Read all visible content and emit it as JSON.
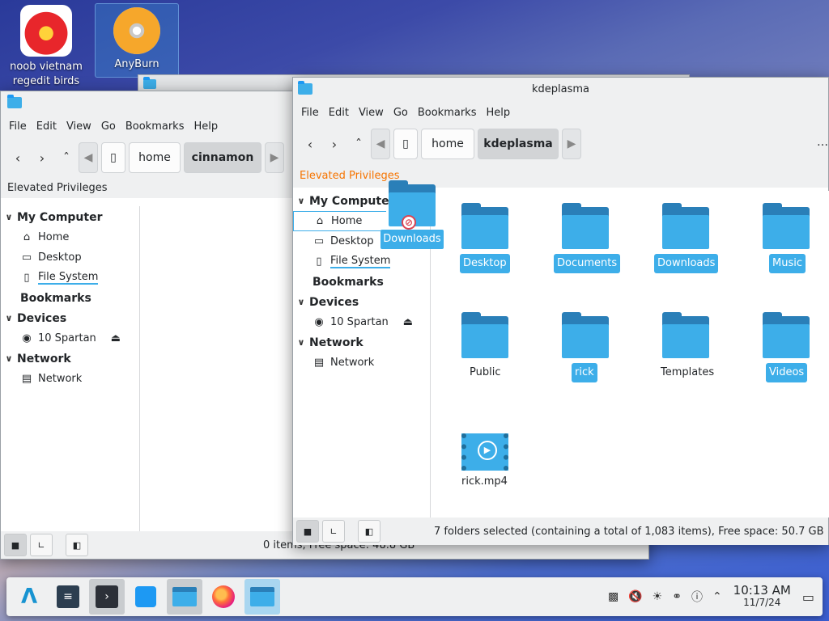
{
  "desktop": {
    "icons": [
      {
        "label": "noob vietnam regedit birds"
      },
      {
        "label": "AnyBurn"
      }
    ]
  },
  "cinnamon_window": {
    "menu": [
      "File",
      "Edit",
      "View",
      "Go",
      "Bookmarks",
      "Help"
    ],
    "breadcrumbs": [
      "home",
      "cinnamon"
    ],
    "elevated": "Elevated Privileges",
    "sidebar": {
      "my_computer": "My Computer",
      "home": "Home",
      "desktop": "Desktop",
      "filesystem": "File System",
      "bookmarks": "Bookmarks",
      "devices": "Devices",
      "device1": "10 Spartan",
      "network": "Network",
      "network_item": "Network"
    },
    "status": "0 items, Free space: 48.8 GB"
  },
  "kde_window": {
    "title": "kdeplasma",
    "menu": [
      "File",
      "Edit",
      "View",
      "Go",
      "Bookmarks",
      "Help"
    ],
    "breadcrumbs": [
      "home",
      "kdeplasma"
    ],
    "elevated": "Elevated Privileges",
    "sidebar": {
      "my_computer": "My Computer",
      "home": "Home",
      "desktop": "Desktop",
      "filesystem": "File System",
      "bookmarks": "Bookmarks",
      "devices": "Devices",
      "device1": "10 Spartan",
      "network": "Network",
      "network_item": "Network"
    },
    "files": [
      {
        "name": "Desktop",
        "selected": true
      },
      {
        "name": "Documents",
        "selected": true
      },
      {
        "name": "Downloads",
        "selected": true
      },
      {
        "name": "Music",
        "selected": true
      },
      {
        "name": "Public",
        "selected": false
      },
      {
        "name": "rick",
        "selected": true
      },
      {
        "name": "Templates",
        "selected": false
      },
      {
        "name": "Videos",
        "selected": true
      },
      {
        "name": "rick.mp4",
        "selected": false
      }
    ],
    "status": "7 folders selected (containing a total of 1,083 items), Free space: 50.7 GB"
  },
  "drag": {
    "label": "Downloads"
  },
  "taskbar": {
    "time": "10:13 AM",
    "date": "11/7/24"
  },
  "colors": {
    "accent": "#3daee9",
    "folder_dark": "#2a7fb8",
    "elevated": "#f67400"
  }
}
